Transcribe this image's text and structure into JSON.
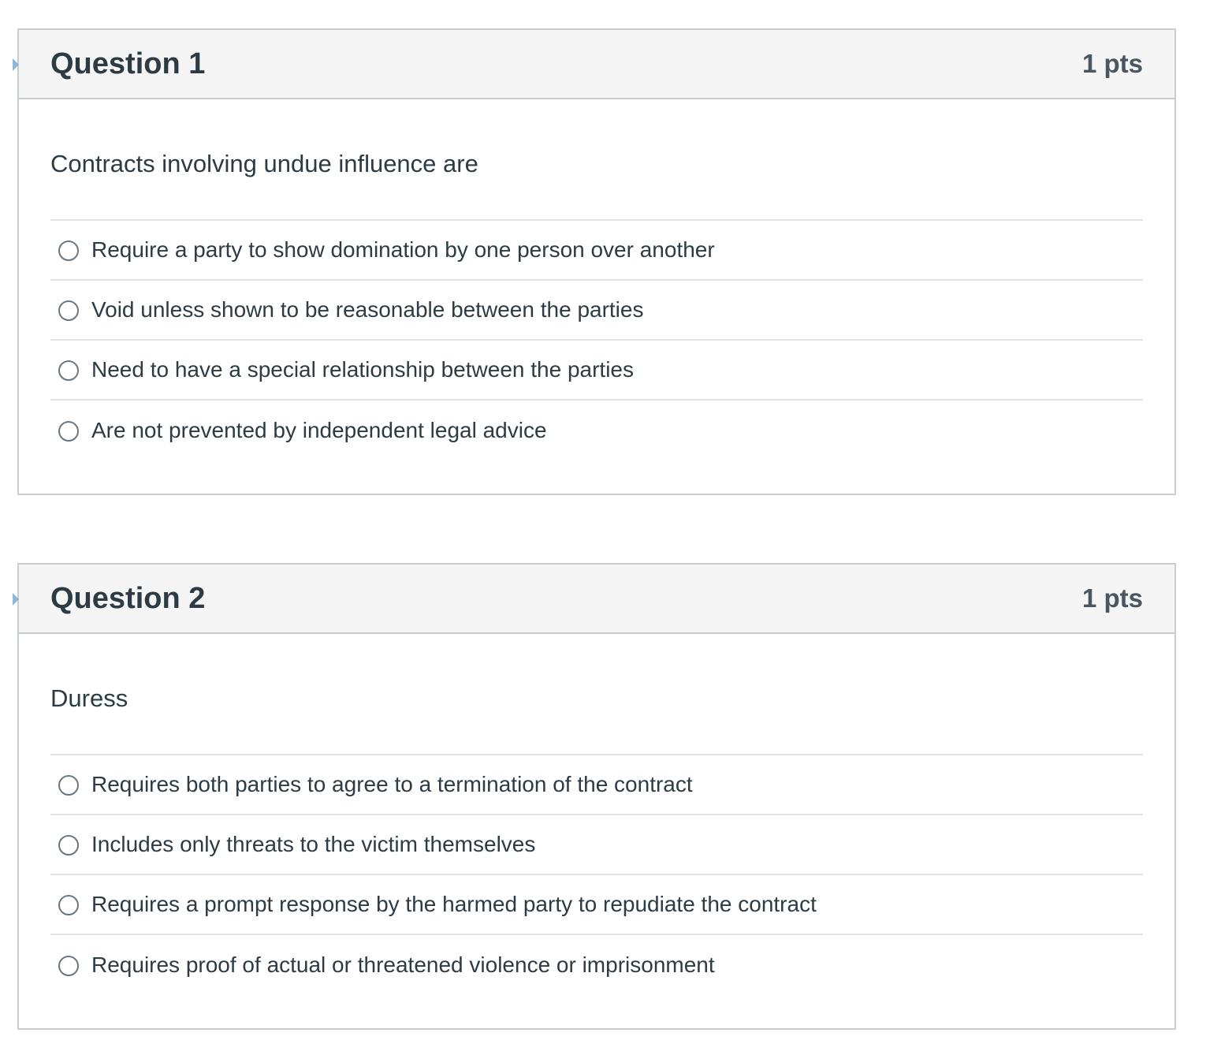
{
  "questions": [
    {
      "title": "Question 1",
      "points": "1 pts",
      "text": "Contracts involving undue influence are",
      "answers": [
        "Require a party to show domination by one person over another",
        "Void unless shown to be reasonable between the parties",
        "Need to have a special relationship between the parties",
        "Are not prevented by independent legal advice"
      ]
    },
    {
      "title": "Question 2",
      "points": "1 pts",
      "text": "Duress",
      "answers": [
        "Requires both parties to agree to a termination of the contract",
        "Includes only threats to the victim themselves",
        "Requires a prompt response by the harmed party to repudiate the contract",
        "Requires proof of actual or threatened violence or imprisonment"
      ]
    }
  ]
}
